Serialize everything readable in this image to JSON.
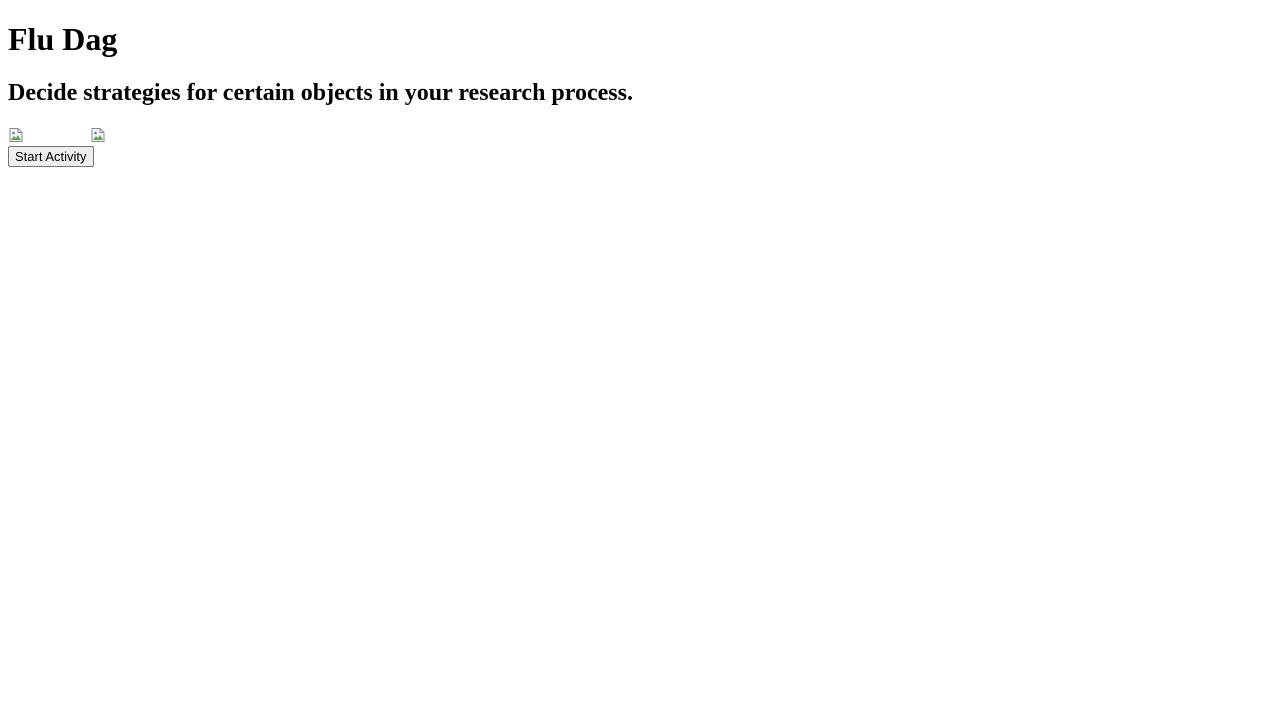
{
  "header": {
    "title": "Flu Dag",
    "subtitle": "Decide strategies for certain objects in your research process."
  },
  "images": [
    {
      "icon": "broken-image-icon"
    },
    {
      "icon": "broken-image-icon"
    }
  ],
  "actions": {
    "start_label": "Start Activity"
  }
}
